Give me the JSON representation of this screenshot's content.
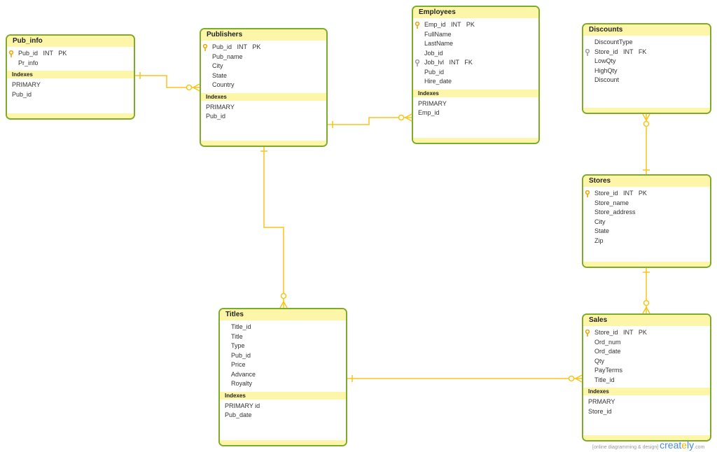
{
  "colors": {
    "border": "#7fab2a",
    "header": "#fdf6a8",
    "connector": "#f5c518",
    "pk_key": "#e9a800",
    "fk_key": "#a0a0a0"
  },
  "indexes_label": "Indexes",
  "tables": [
    {
      "id": "pub_info",
      "name": "Pub_info",
      "fields": [
        {
          "text": "Pub_id   INT   PK",
          "key": "pk"
        },
        {
          "text": "Pr_info"
        }
      ],
      "indexes": [
        "PRIMARY",
        "Pub_id"
      ]
    },
    {
      "id": "publishers",
      "name": "Publishers",
      "fields": [
        {
          "text": "Pub_id   INT   PK",
          "key": "pk"
        },
        {
          "text": "Pub_name"
        },
        {
          "text": "City"
        },
        {
          "text": "State"
        },
        {
          "text": "Country"
        }
      ],
      "indexes": [
        "PRIMARY",
        "Pub_id"
      ]
    },
    {
      "id": "employees",
      "name": "Employees",
      "fields": [
        {
          "text": "Emp_id   INT   PK",
          "key": "pk"
        },
        {
          "text": "FullName"
        },
        {
          "text": "LastName"
        },
        {
          "text": "Job_id"
        },
        {
          "text": "Job_lvl   INT   FK",
          "key": "fk"
        },
        {
          "text": "Pub_id"
        },
        {
          "text": "Hire_date"
        }
      ],
      "indexes": [
        "PRIMARY",
        "Emp_id"
      ]
    },
    {
      "id": "discounts",
      "name": "Discounts",
      "fields": [
        {
          "text": "DiscountType"
        },
        {
          "text": "Store_id   INT   FK",
          "key": "fk"
        },
        {
          "text": "LowQty"
        },
        {
          "text": "HighQty"
        },
        {
          "text": "Discount"
        }
      ],
      "indexes": []
    },
    {
      "id": "stores",
      "name": "Stores",
      "fields": [
        {
          "text": "Store_id   INT   PK",
          "key": "pk"
        },
        {
          "text": "Store_name"
        },
        {
          "text": "Store_address"
        },
        {
          "text": "City"
        },
        {
          "text": "State"
        },
        {
          "text": "Zip"
        }
      ],
      "indexes": []
    },
    {
      "id": "titles",
      "name": "Titles",
      "fields": [
        {
          "text": "Title_id"
        },
        {
          "text": "Title"
        },
        {
          "text": "Type"
        },
        {
          "text": "Pub_id"
        },
        {
          "text": "Price"
        },
        {
          "text": "Advance"
        },
        {
          "text": "Royalty"
        }
      ],
      "indexes": [
        "PRIMARY   id",
        "Pub_date"
      ]
    },
    {
      "id": "sales",
      "name": "Sales",
      "fields": [
        {
          "text": "Store_id   INT   PK",
          "key": "pk"
        },
        {
          "text": "Ord_num"
        },
        {
          "text": "Ord_date"
        },
        {
          "text": "Qty"
        },
        {
          "text": "PayTerms"
        },
        {
          "text": "Title_id"
        }
      ],
      "indexes": [
        "PRMARY",
        "Store_id"
      ]
    }
  ],
  "relationships": [
    {
      "from": "pub_info",
      "to": "publishers",
      "type": "one-to-zero-or-many"
    },
    {
      "from": "publishers",
      "to": "employees",
      "type": "one-to-zero-or-many"
    },
    {
      "from": "publishers",
      "to": "titles",
      "type": "one-to-zero-or-many"
    },
    {
      "from": "stores",
      "to": "discounts",
      "type": "one-to-zero-or-many"
    },
    {
      "from": "stores",
      "to": "sales",
      "type": "one-to-zero-or-many"
    },
    {
      "from": "titles",
      "to": "sales",
      "type": "one-to-zero-or-many"
    }
  ],
  "branding": {
    "tagline": "[online diagramming & design]",
    "logo": "creately",
    "domain": ".com"
  }
}
